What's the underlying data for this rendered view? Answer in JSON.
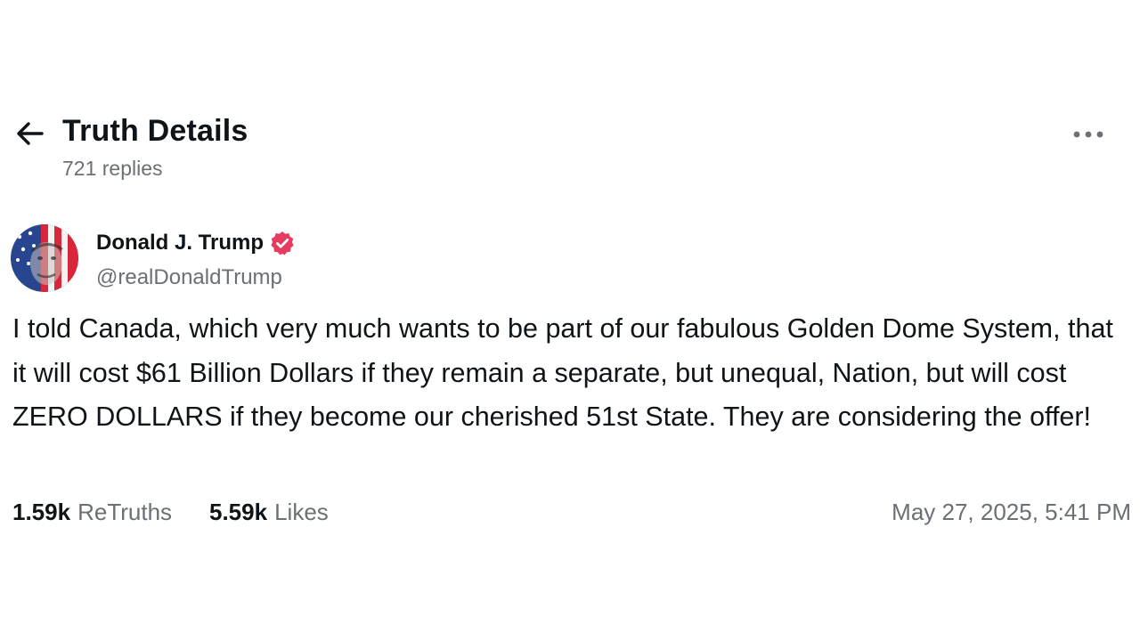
{
  "header": {
    "back_icon": "arrow-left-icon",
    "title": "Truth Details",
    "replies": "721 replies",
    "more_icon": "more-horizontal-icon"
  },
  "post": {
    "author": {
      "name": "Donald J. Trump",
      "handle": "@realDonaldTrump",
      "verified_icon": "verified-badge-icon",
      "verified_color": "#e63c60",
      "avatar_icon": "avatar-image"
    },
    "text": "I told Canada, which very much wants to be part of our fabulous Golden Dome System, that it will cost $61 Billion Dollars if they remain a separate, but unequal, Nation, but will cost ZERO DOLLARS if they become our cherished 51st State. They are considering the offer!",
    "stats": {
      "retruths_count": "1.59k",
      "retruths_label": "ReTruths",
      "likes_count": "5.59k",
      "likes_label": "Likes"
    },
    "timestamp": "May 27, 2025, 5:41 PM"
  },
  "colors": {
    "text_primary": "#0f1419",
    "text_secondary": "#6b6f76",
    "background": "#ffffff"
  }
}
